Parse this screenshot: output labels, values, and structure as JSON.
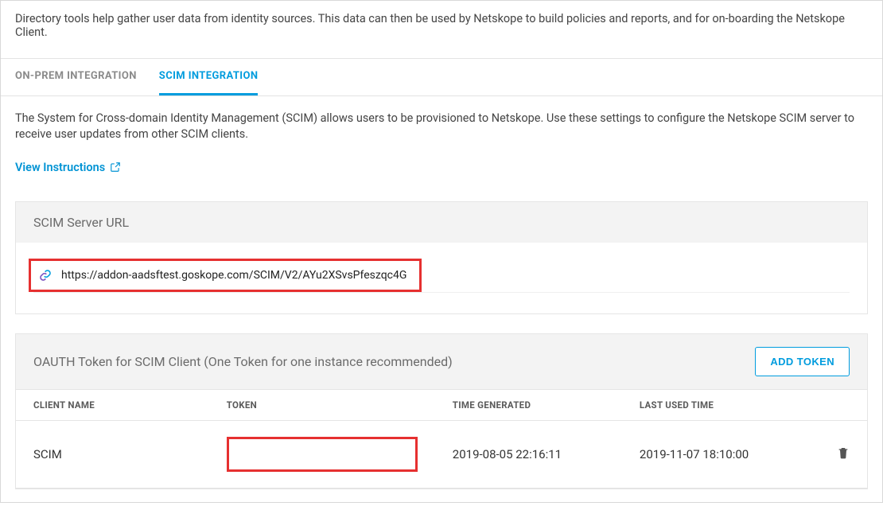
{
  "intro": "Directory tools help gather user data from identity sources. This data can then be used by Netskope to build policies and reports, and for on-boarding the Netskope Client.",
  "tabs": {
    "onprem": "ON-PREM INTEGRATION",
    "scim": "SCIM INTEGRATION"
  },
  "scim_desc": "The System for Cross-domain Identity Management (SCIM) allows users to be provisioned to Netskope. Use these settings to configure the Netskope SCIM server to receive user updates from other SCIM clients.",
  "view_instructions": "View Instructions",
  "scim_server": {
    "title": "SCIM Server URL",
    "url": "https://addon-aadsftest.goskope.com/SCIM/V2/AYu2XSvsPfeszqc4G"
  },
  "oauth": {
    "title": "OAUTH Token for SCIM Client (One Token for one instance recommended)",
    "add_token": "ADD TOKEN",
    "columns": {
      "client_name": "CLIENT NAME",
      "token": "TOKEN",
      "time_generated": "TIME GENERATED",
      "last_used": "LAST USED TIME"
    },
    "rows": [
      {
        "client_name": "SCIM",
        "token": "",
        "time_generated": "2019-08-05 22:16:11",
        "last_used": "2019-11-07 18:10:00"
      }
    ]
  }
}
